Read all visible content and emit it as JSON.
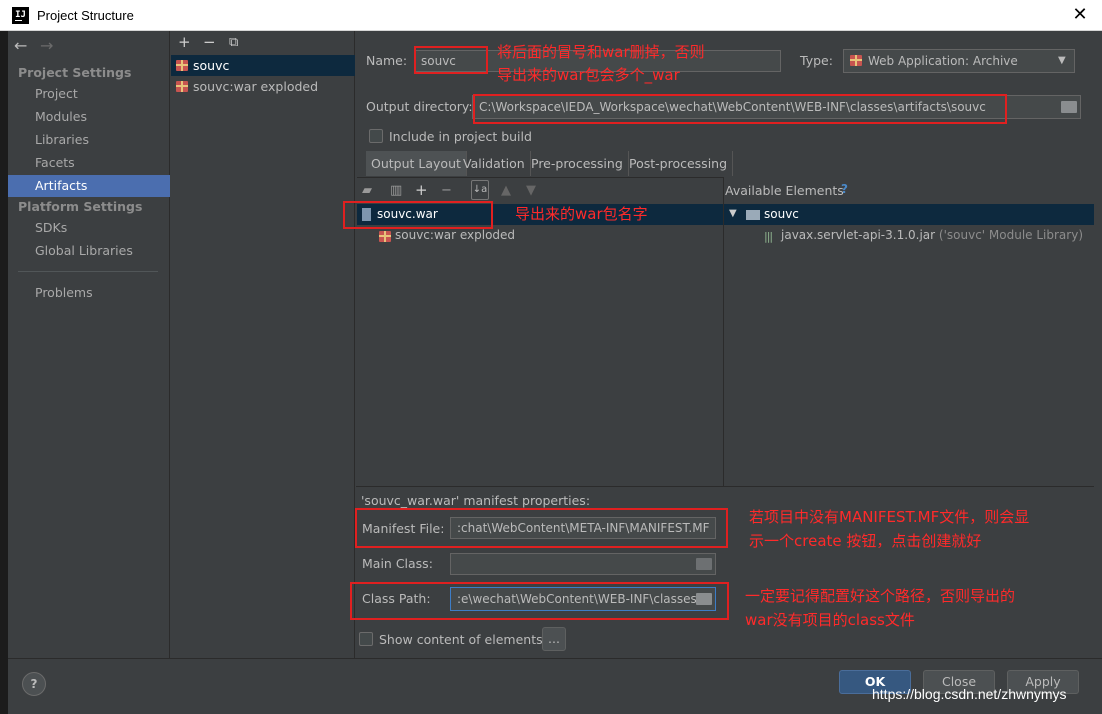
{
  "window": {
    "title": "Project Structure",
    "close": "✕",
    "app_icon": "IJ"
  },
  "nav": {
    "back": "←",
    "forward": "→",
    "project_settings_header": "Project Settings",
    "project_settings": [
      "Project",
      "Modules",
      "Libraries",
      "Facets",
      "Artifacts"
    ],
    "platform_settings_header": "Platform Settings",
    "platform_settings": [
      "SDKs",
      "Global Libraries"
    ],
    "problems": "Problems",
    "selected": "Artifacts"
  },
  "artifact_list": {
    "toolbar": [
      "+",
      "−",
      "⧉"
    ],
    "items": [
      "souvc",
      "souvc:war exploded"
    ]
  },
  "form": {
    "name_label": "Name:",
    "name_value": "souvc",
    "type_label": "Type:",
    "type_value": "Web Application: Archive",
    "output_dir_label": "Output directory:",
    "output_dir_value": "C:\\Workspace\\IEDA_Workspace\\wechat\\WebContent\\WEB-INF\\classes\\artifacts\\souvc",
    "include_build_label": "Include in project build",
    "tabs": [
      "Output Layout",
      "Validation",
      "Pre-processing",
      "Post-processing"
    ],
    "available_elements_label": "Available Elements",
    "help_mark": "?",
    "layout_tree": [
      "souvc.war",
      "souvc:war exploded"
    ],
    "available_tree": {
      "root": "souvc",
      "child": "javax.servlet-api-3.1.0.jar",
      "child_note": "('souvc' Module Library)"
    },
    "manifest_header": "'souvc_war.war' manifest properties:",
    "manifest_file_label": "Manifest File:",
    "manifest_file_value": ":chat\\WebContent\\META-INF\\MANIFEST.MF",
    "main_class_label": "Main Class:",
    "main_class_value": "",
    "class_path_label": "Class Path:",
    "class_path_value": ":e\\wechat\\WebContent\\WEB-INF\\classes",
    "show_content_label": "Show content of elements",
    "ellipsis_button": "..."
  },
  "buttons": {
    "help": "?",
    "ok": "OK",
    "close": "Close",
    "apply": "Apply"
  },
  "annotations": {
    "name_note_1": "将后面的冒号和war删掉，否则",
    "name_note_2": "导出来的war包会多个_war",
    "war_note": "导出来的war包名字",
    "manifest_note_1": "若项目中没有MANIFEST.MF文件，则会显",
    "manifest_note_2": "示一个create 按钮，点击创建就好",
    "classpath_note_1": "一定要记得配置好这个路径，否则导出的",
    "classpath_note_2": "war没有项目的class文件"
  },
  "watermark": "https://blog.csdn.net/zhwnymys",
  "colors": {
    "background": "#3c3f41",
    "selection": "#4b6eaf",
    "annotation_red": "#e02020"
  }
}
